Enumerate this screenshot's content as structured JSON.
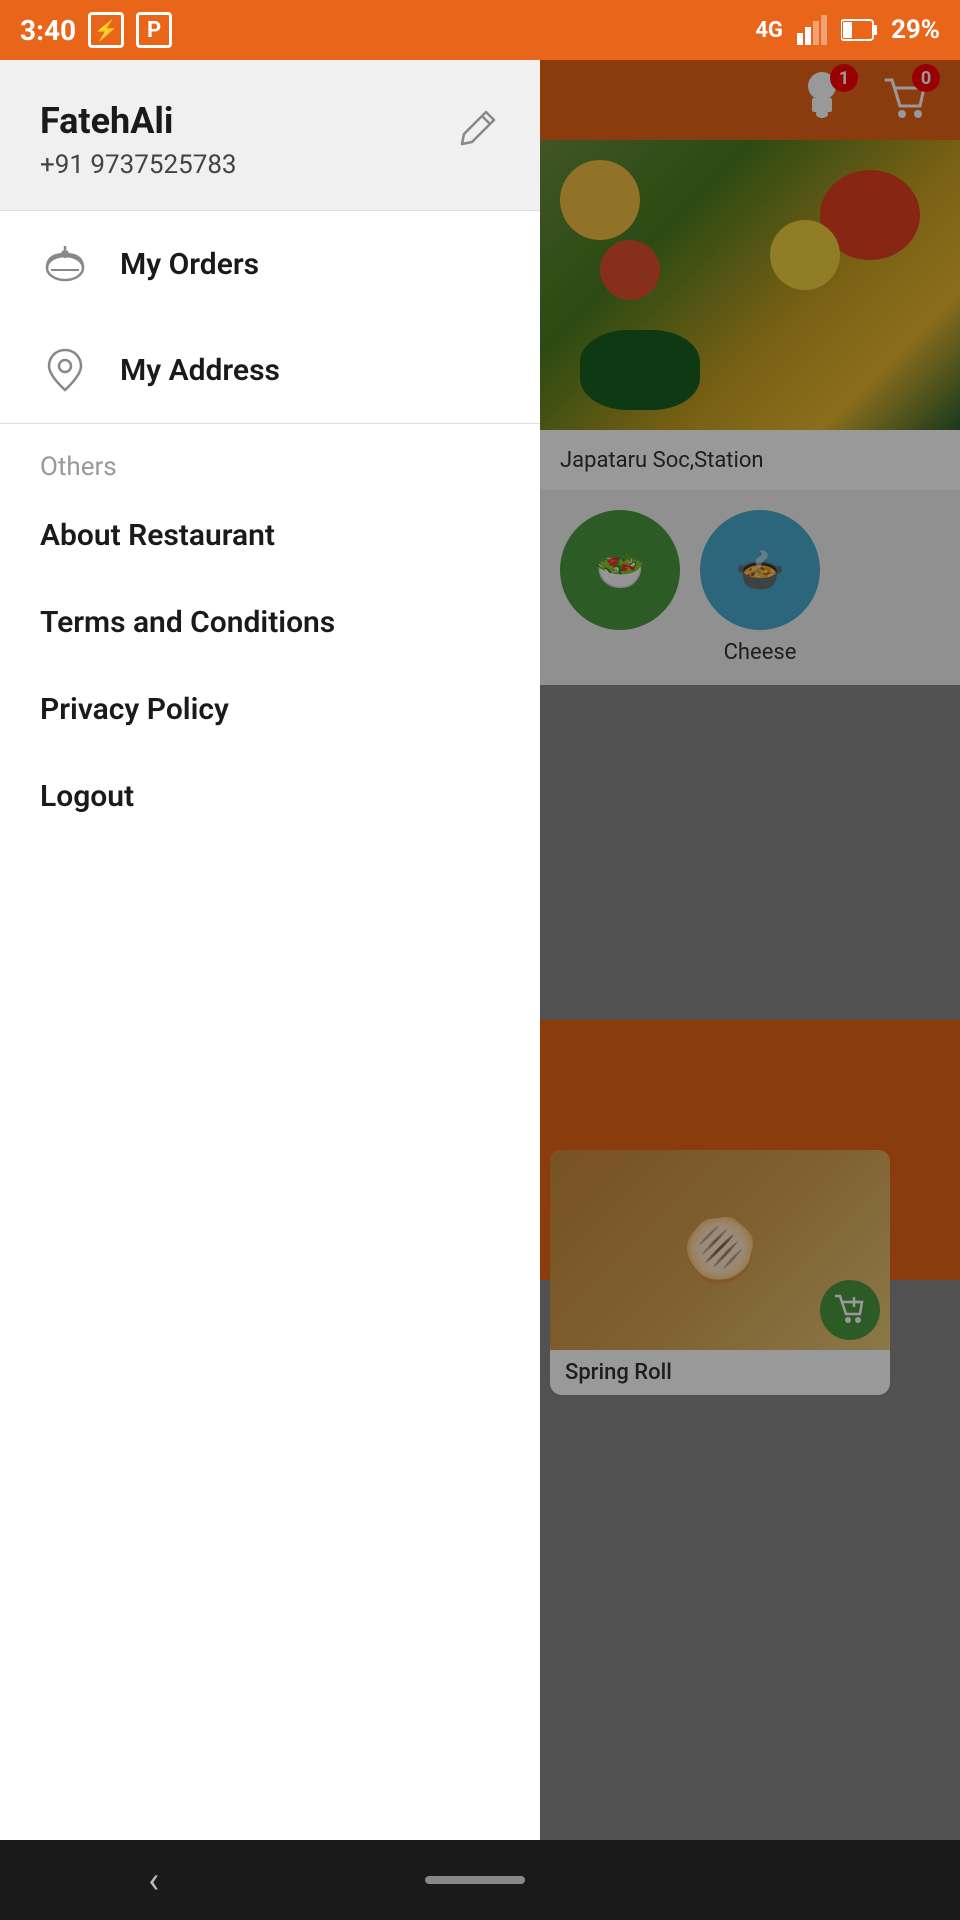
{
  "statusBar": {
    "time": "3:40",
    "battery": "29%",
    "network": "4G"
  },
  "topbar": {
    "cartCount": "0",
    "notificationBadge": "1"
  },
  "userProfile": {
    "name": "FatehAli",
    "phone": "+91 9737525783",
    "editLabel": "Edit"
  },
  "menu": {
    "items": [
      {
        "id": "my-orders",
        "label": "My Orders",
        "icon": "orders"
      },
      {
        "id": "my-address",
        "label": "My Address",
        "icon": "location"
      }
    ],
    "othersHeader": "Others",
    "othersItems": [
      {
        "id": "about-restaurant",
        "label": "About Restaurant"
      },
      {
        "id": "terms",
        "label": "Terms and Conditions"
      },
      {
        "id": "privacy",
        "label": "Privacy Policy"
      },
      {
        "id": "logout",
        "label": "Logout"
      }
    ]
  },
  "mainContent": {
    "address": "Japataru Soc,Station",
    "categories": [
      {
        "label": "Cheese",
        "color": "blue"
      }
    ],
    "foodCard": {
      "name": "Spring Roll"
    }
  },
  "bottomNav": {
    "backLabel": "‹"
  }
}
